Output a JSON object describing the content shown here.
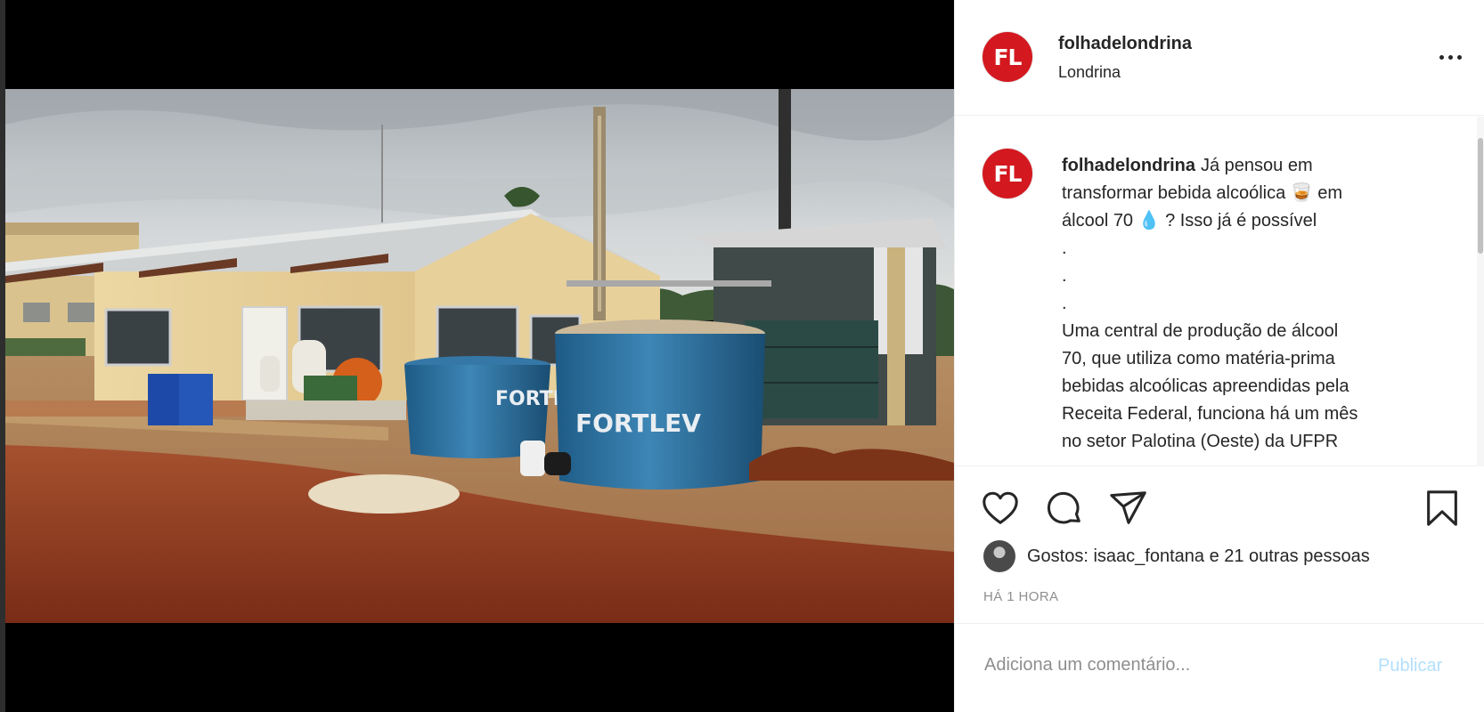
{
  "post": {
    "image_alt": "photo"
  },
  "header": {
    "avatar_initials": "FL",
    "username": "folhadelondrina",
    "location": "Londrina"
  },
  "caption": {
    "username": "folhadelondrina",
    "lines": [
      "Já pensou em",
      "transformar bebida alcoólica 🥃 em",
      "álcool 70 💧 ? Isso já é possível",
      ".",
      ".",
      ".",
      "Uma central de produção de álcool",
      "70, que utiliza como matéria-prima",
      "bebidas alcoólicas apreendidas pela",
      "Receita Federal, funciona há um mês",
      "no setor Palotina (Oeste) da UFPR"
    ]
  },
  "actions": {
    "like": "heart-icon",
    "comment": "comment-icon",
    "share": "share-icon",
    "save": "bookmark-icon"
  },
  "likes": {
    "text": "Gostos: isaac_fontana e 21 outras pessoas"
  },
  "timestamp": "HÁ 1 HORA",
  "comment_box": {
    "placeholder": "Adiciona um comentário...",
    "publish_label": "Publicar"
  },
  "colors": {
    "brand_red": "#d3181f",
    "publish_disabled": "#b2dffc",
    "text_primary": "#262626",
    "text_secondary": "#8e8e8e"
  }
}
